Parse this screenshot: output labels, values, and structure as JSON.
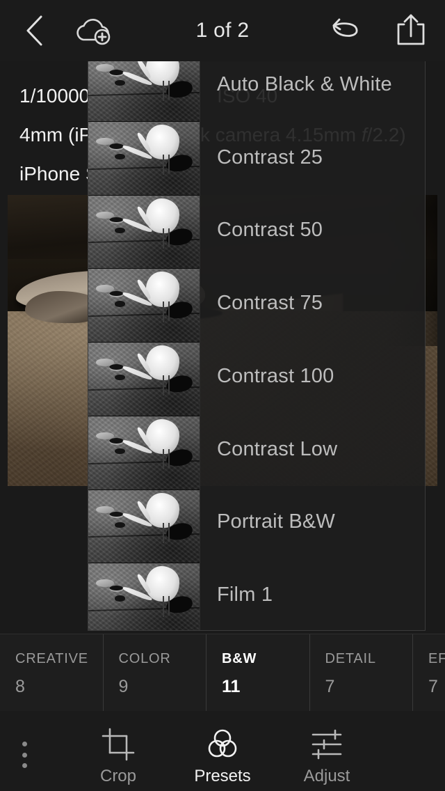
{
  "topbar": {
    "title": "1 of 2",
    "back_icon": "chevron-left-icon",
    "cloud_icon": "cloud-add-icon",
    "undo_icon": "undo-icon",
    "share_icon": "share-export-icon"
  },
  "metadata": {
    "line1_visible": "1/10000",
    "line1_ghost": "ISO 40",
    "line2_visible": "4mm (iP",
    "line2_ghost_pre": "k camera 4.15mm ",
    "line2_ghost_italic": "f",
    "line2_ghost_post": "/2.2)",
    "line3_visible": "iPhone S"
  },
  "presets": {
    "items": [
      {
        "label": "Auto Black & White"
      },
      {
        "label": "Contrast 25"
      },
      {
        "label": "Contrast 50"
      },
      {
        "label": "Contrast 75"
      },
      {
        "label": "Contrast 100"
      },
      {
        "label": "Contrast Low"
      },
      {
        "label": "Portrait B&W"
      },
      {
        "label": "Film 1"
      }
    ]
  },
  "categories": [
    {
      "name": "CREATIVE",
      "count": "8",
      "active": false
    },
    {
      "name": "COLOR",
      "count": "9",
      "active": false
    },
    {
      "name": "B&W",
      "count": "11",
      "active": true
    },
    {
      "name": "DETAIL",
      "count": "7",
      "active": false
    },
    {
      "name": "EFF",
      "count": "7",
      "active": false
    }
  ],
  "toolbar": {
    "more_icon": "more-vertical-icon",
    "crop_label": "Crop",
    "crop_icon": "crop-icon",
    "presets_label": "Presets",
    "presets_icon": "presets-circles-icon",
    "adjust_label": "Adjust",
    "adjust_icon": "sliders-icon"
  },
  "colors": {
    "app_bg": "#1b1b1b",
    "panel_bg": "#1e1e1e",
    "text_primary": "#f2f2f2",
    "text_muted": "#9a9a9a",
    "preset_label": "#bdbdbd",
    "divider": "#3a3a3a"
  }
}
